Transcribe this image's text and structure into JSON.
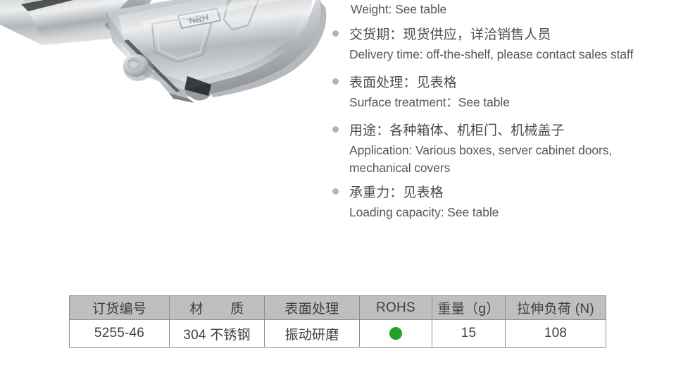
{
  "product_image": {
    "alt": "Stainless steel toggle latch / draw latch, close-up",
    "brand_mark": "NRH",
    "finish_color": "#c9ccce"
  },
  "specs": [
    {
      "id": "weight",
      "has_bullet": false,
      "cn": "",
      "en": "Weight: See table"
    },
    {
      "id": "delivery",
      "has_bullet": true,
      "cn": "交货期：现货供应，详洽销售人员",
      "en": "Delivery time: off-the-shelf, please contact sales staff"
    },
    {
      "id": "surface",
      "has_bullet": true,
      "cn": "表面处理：见表格",
      "en": "Surface treatment：See table"
    },
    {
      "id": "application",
      "has_bullet": true,
      "cn": "用途：各种箱体、机柜门、机械盖子",
      "en": "Application: Various boxes, server cabinet doors, mechanical covers"
    },
    {
      "id": "loading",
      "has_bullet": true,
      "cn": "承重力：见表格",
      "en": "Loading capacity: See table"
    }
  ],
  "table": {
    "headers": [
      "订货编号",
      "材　　质",
      "表面处理",
      "ROHS",
      "重量（g）",
      "拉伸负荷 (N)"
    ],
    "rows": [
      {
        "order_code": "5255-46",
        "material": "304 不锈钢",
        "surface": "振动研磨",
        "rohs": "compliant-green-dot",
        "weight": "15",
        "load": "108"
      }
    ],
    "colors": {
      "header_bg": "#bfbfbf",
      "border": "#8c8c8c",
      "rohs_dot": "#21a02b"
    }
  }
}
